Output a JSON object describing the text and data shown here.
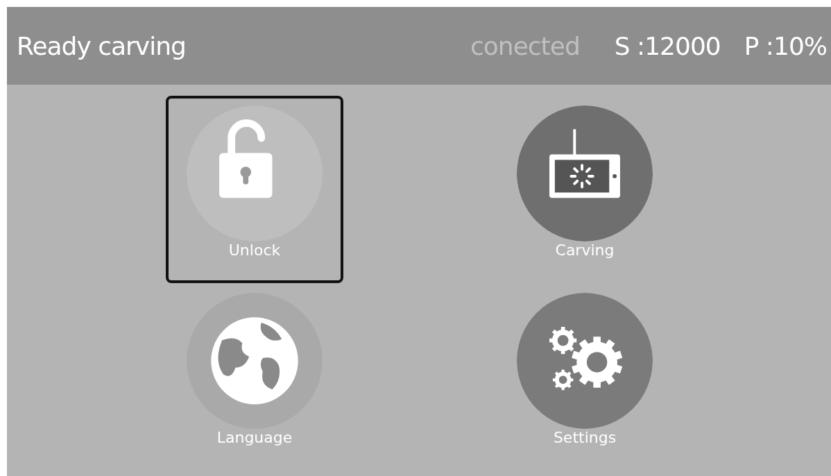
{
  "header": {
    "title": "Ready carving",
    "connection": "conected",
    "spindle": "S :12000",
    "power": "P :10%"
  },
  "menu": [
    {
      "kind": "unlock",
      "label": "Unlock",
      "selected": true
    },
    {
      "kind": "carving",
      "label": "Carving",
      "selected": false
    },
    {
      "kind": "language",
      "label": "Language",
      "selected": false
    },
    {
      "kind": "settings",
      "label": "Settings",
      "selected": false
    }
  ]
}
